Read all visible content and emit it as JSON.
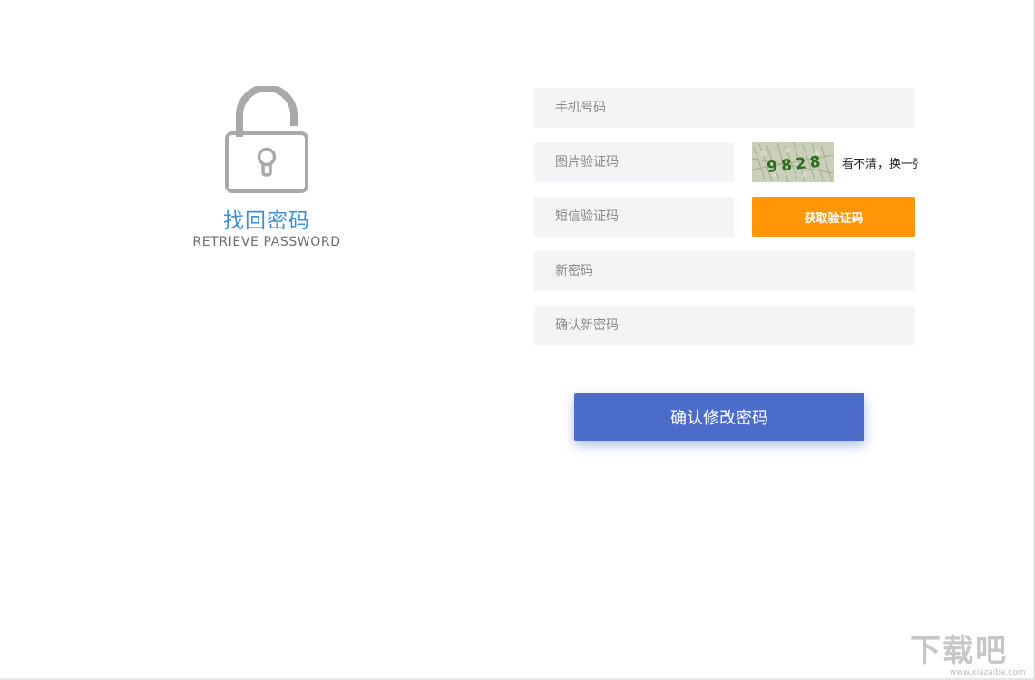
{
  "branding": {
    "title": "找回密码",
    "subtitle": "RETRIEVE PASSWORD"
  },
  "form": {
    "phone_placeholder": "手机号码",
    "captcha_placeholder": "图片验证码",
    "captcha_image_text": "9828",
    "captcha_refresh_label": "看不清，换一张",
    "sms_placeholder": "短信验证码",
    "sms_button_label": "获取验证码",
    "new_password_placeholder": "新密码",
    "confirm_password_placeholder": "确认新密码",
    "submit_label": "确认修改密码"
  },
  "colors": {
    "brand_blue": "#3d8fd6",
    "sms_button": "#ff9507",
    "submit_button": "#4b6cc9",
    "field_bg": "#f4f4f6"
  },
  "watermark": {
    "logo_text": "下载吧",
    "url": "www.xiazaiba.com"
  }
}
